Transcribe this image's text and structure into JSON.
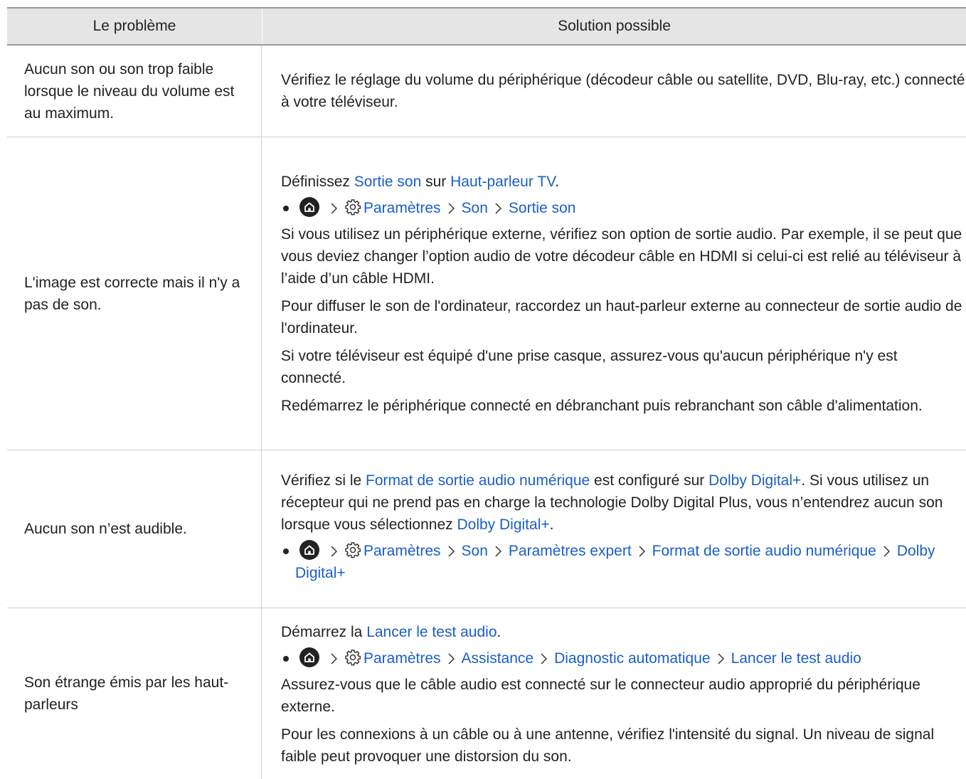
{
  "header": {
    "col1": "Le problème",
    "col2": "Solution possible"
  },
  "rows": [
    {
      "problem": "Aucun son ou son trop faible lorsque le niveau du volume est au maximum.",
      "p1": "Vérifiez le réglage du volume du périphérique (décodeur câble ou satellite, DVD, Blu-ray, etc.) connecté à votre téléviseur."
    },
    {
      "problem": "L'image est correcte mais il n'y a pas de son.",
      "intro_a": "Définissez ",
      "intro_b": "Sortie son",
      "intro_c": " sur ",
      "intro_d": "Haut-parleur TV",
      "intro_e": ".",
      "path": [
        "Paramètres",
        "Son",
        "Sortie son"
      ],
      "p2": "Si vous utilisez un périphérique externe, vérifiez son option de sortie audio. Par exemple, il se peut que vous deviez changer l’option audio de votre décodeur câble en HDMI si celui-ci est relié au téléviseur à l’aide d’un câble HDMI.",
      "p3": "Pour diffuser le son de l'ordinateur, raccordez un haut-parleur externe au connecteur de sortie audio de l'ordinateur.",
      "p4": "Si votre téléviseur est équipé d'une prise casque, assurez-vous qu'aucun périphérique n'y est connecté.",
      "p5": "Redémarrez le périphérique connecté en débranchant puis rebranchant son câble d'alimentation."
    },
    {
      "problem": "Aucun son n’est audible.",
      "t1": "Vérifiez si le ",
      "t2": "Format de sortie audio numérique",
      "t3": " est configuré sur ",
      "t4": "Dolby Digital+",
      "t5": ". Si vous utilisez un récepteur qui ne prend pas en charge la technologie Dolby Digital Plus, vous n’entendrez aucun son lorsque vous sélectionnez ",
      "t6": "Dolby Digital+",
      "t7": ".",
      "path": [
        "Paramètres",
        "Son",
        "Paramètres expert",
        "Format de sortie audio numérique",
        "Dolby Digital+"
      ]
    },
    {
      "problem": "Son étrange émis par les haut-parleurs",
      "intro_a": "Démarrez la ",
      "intro_b": "Lancer le test audio",
      "intro_c": ".",
      "path": [
        "Paramètres",
        "Assistance",
        "Diagnostic automatique",
        "Lancer le test audio"
      ],
      "p2": "Assurez-vous que le câble audio est connecté sur le connecteur audio approprié du périphérique externe.",
      "p3": "Pour les connexions à un câble ou à une antenne, vérifiez l'intensité du signal. Un niveau de signal faible peut provoquer une distorsion du son."
    }
  ],
  "icons": {
    "home": "home-icon",
    "settings": "gear-icon",
    "separator": "chevron-right-icon"
  },
  "colors": {
    "link": "#1a5fc7",
    "header_bg": "#e5e5e5",
    "text": "#222222"
  }
}
